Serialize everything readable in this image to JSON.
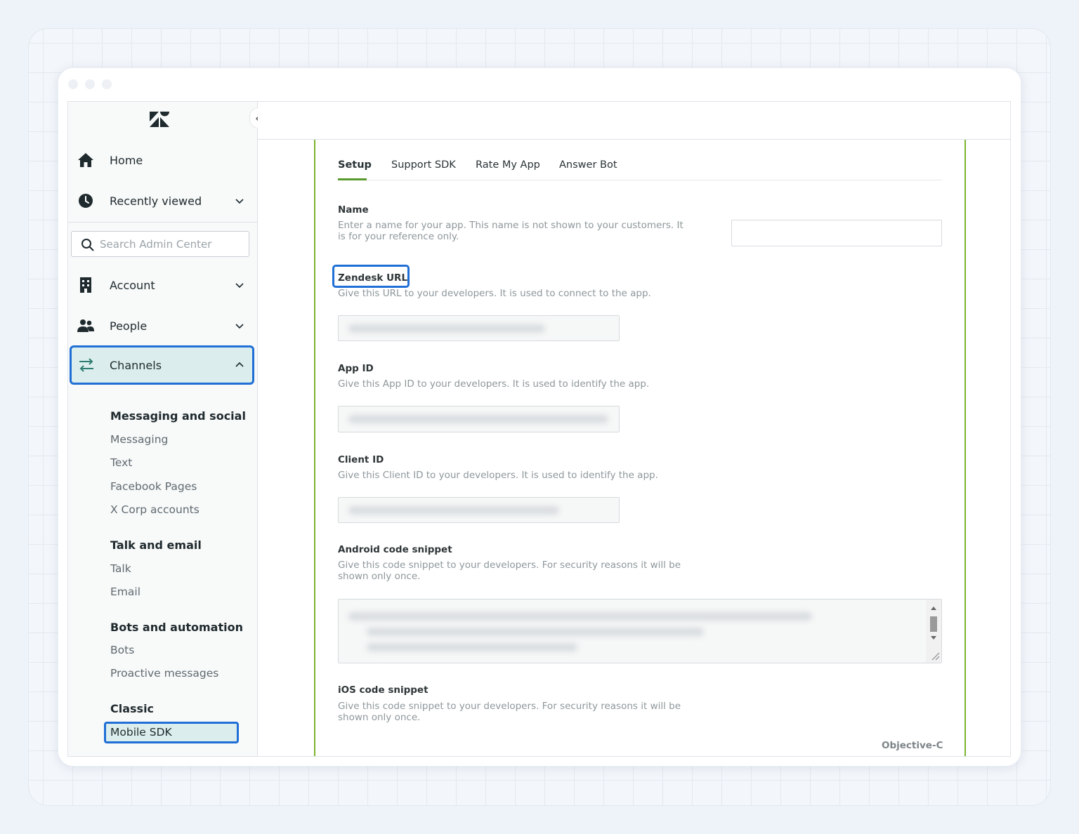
{
  "sidebar": {
    "home": "Home",
    "recently_viewed": "Recently viewed",
    "search_placeholder": "Search Admin Center",
    "account": "Account",
    "people": "People",
    "channels": "Channels",
    "groups": [
      {
        "title": "Messaging and social",
        "items": [
          "Messaging",
          "Text",
          "Facebook Pages",
          "X Corp accounts"
        ]
      },
      {
        "title": "Talk and email",
        "items": [
          "Talk",
          "Email"
        ]
      },
      {
        "title": "Bots and automation",
        "items": [
          "Bots",
          "Proactive messages"
        ]
      },
      {
        "title": "Classic",
        "items": [
          "Mobile SDK"
        ]
      }
    ]
  },
  "tabs": [
    "Setup",
    "Support SDK",
    "Rate My App",
    "Answer Bot"
  ],
  "fields": {
    "name_label": "Name",
    "name_help": "Enter a name for your app. This name is not shown to your customers. It is for your reference only.",
    "url_label": "Zendesk URL",
    "url_help": "Give this URL to your developers. It is used to connect to the app.",
    "appid_label": "App ID",
    "appid_help": "Give this App ID to your developers. It is used to identify the app.",
    "clientid_label": "Client ID",
    "clientid_help": "Give this Client ID to your developers. It is used to identify the app.",
    "android_label": "Android code snippet",
    "android_help": "Give this code snippet to your developers. For security reasons it will be shown only once.",
    "ios_label": "iOS code snippet",
    "ios_help": "Give this code snippet to your developers. For security reasons it will be shown only once.",
    "ios_lang": "Objective-C"
  },
  "colors": {
    "accent": "#1f6fd6",
    "brand_green": "#7ab32e",
    "active_bg": "#dbeeed"
  }
}
